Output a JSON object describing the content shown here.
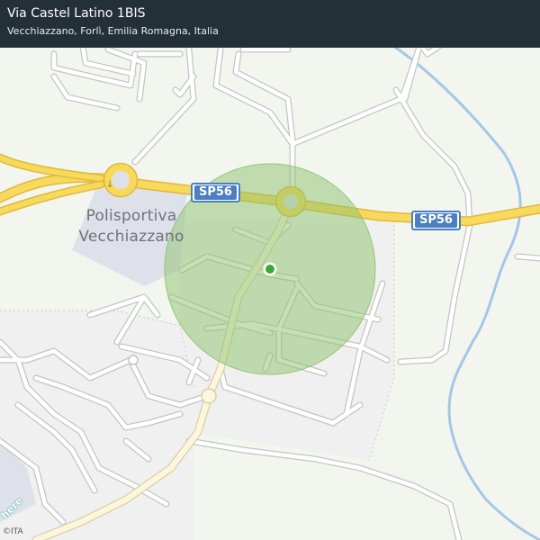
{
  "header": {
    "title": "Via Castel Latino 1BIS",
    "subtitle": "Vecchiazzano, Forlì, Emilia Romagna, Italia"
  },
  "map": {
    "road_labels": [
      {
        "text": "SP56"
      },
      {
        "text": "SP56"
      }
    ],
    "poi_label": {
      "line1": "Polisportiva",
      "line2": "Vecchiazzano"
    },
    "accuracy_circle_color": "#8dc26d",
    "location_dot_color": "#3aaa35",
    "road_color_main": "#f7d95c",
    "water_color": "#a5c6e6",
    "background_color": "#f3f6ee"
  },
  "footer": {
    "logo": "here",
    "copyright": "©ITA"
  }
}
